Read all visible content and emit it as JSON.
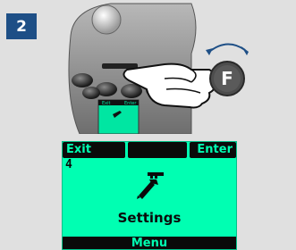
{
  "step": {
    "number": "2"
  },
  "device": {
    "button_letter": "F",
    "mini_screen": {
      "left": "Exit",
      "right": "Enter"
    }
  },
  "lcd": {
    "softkeys": {
      "left": "Exit",
      "middle": "",
      "right": "Enter"
    },
    "screen_number": "4",
    "icon": "wrench-settings-icon",
    "title": "Settings",
    "bottom_bar": "Menu"
  },
  "colors": {
    "badge": "#1e4f86",
    "lcd_background": "#00ffb2",
    "lcd_ink": "#0a0a0a"
  }
}
